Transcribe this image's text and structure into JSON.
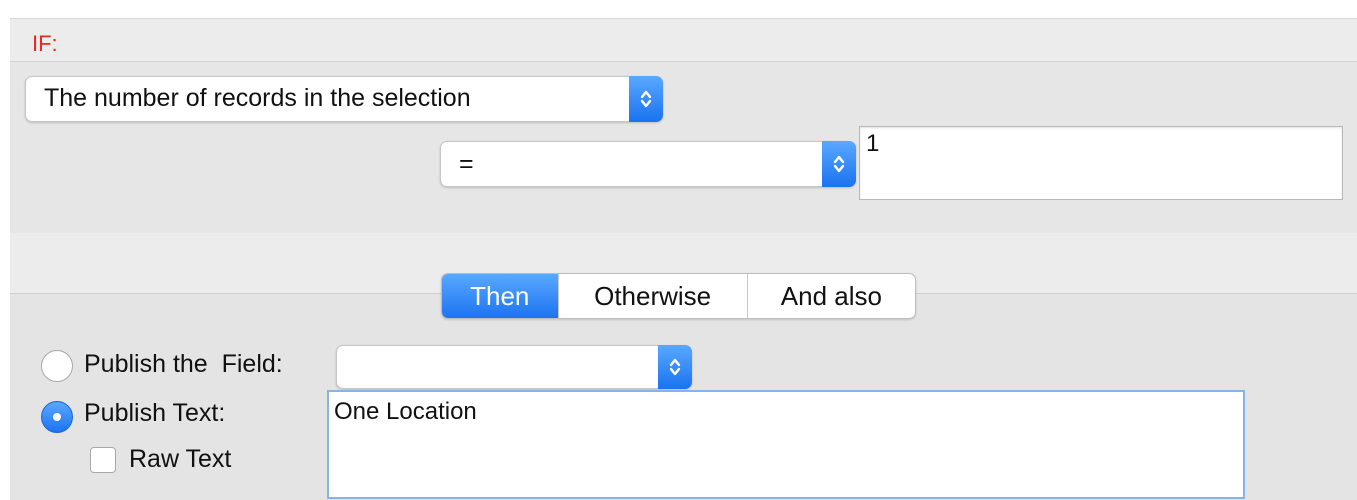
{
  "if_section": {
    "label": "IF:",
    "condition_select": {
      "value": "The number of records in the selection"
    },
    "operator_select": {
      "value": "="
    },
    "value_field": {
      "value": "1"
    }
  },
  "tabs": [
    {
      "label": "Then",
      "active": true
    },
    {
      "label": "Otherwise",
      "active": false
    },
    {
      "label": "And also",
      "active": false
    }
  ],
  "then_section": {
    "publish_field": {
      "label": "Publish the  Field:",
      "selected": false,
      "select_value": ""
    },
    "publish_text": {
      "label": "Publish Text:",
      "selected": true,
      "value": "One Location"
    },
    "raw_text": {
      "label": "Raw Text",
      "checked": false
    }
  },
  "colors": {
    "accent": "#1c74f0",
    "if_label": "#e8281e",
    "focus_ring": "#86b3ea"
  },
  "icons": {
    "select_arrows": "updown-chevron-icon",
    "radio": "radio-icon",
    "checkbox": "checkbox-icon"
  }
}
